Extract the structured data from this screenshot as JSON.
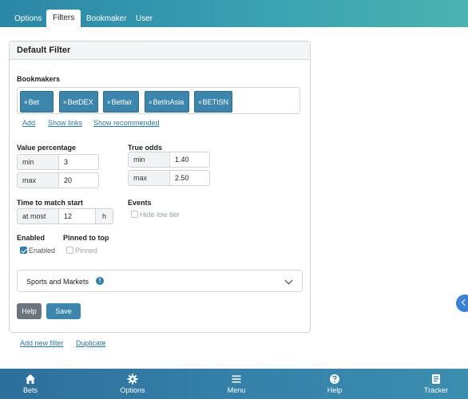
{
  "tabs": [
    {
      "label": "Options",
      "active": false
    },
    {
      "label": "Filters",
      "active": true
    },
    {
      "label": "Bookmaker",
      "active": false
    },
    {
      "label": "User",
      "active": false
    }
  ],
  "card": {
    "title": "Default Filter"
  },
  "bookmakers": {
    "label": "Bookmakers",
    "chips": [
      "Bet",
      "BetDEX",
      "Betfair",
      "BetInAsia",
      "BETISN"
    ],
    "remove_glyph": "×",
    "links": {
      "add": "Add",
      "show_links": "Show links",
      "show_recommended": "Show recommended"
    }
  },
  "value_percentage": {
    "label": "Value percentage",
    "min_label": "min",
    "min_value": "3",
    "max_label": "max",
    "max_value": "20"
  },
  "true_odds": {
    "label": "True odds",
    "min_label": "min",
    "min_value": "1.40",
    "max_label": "max",
    "max_value": "2.50"
  },
  "time_to_match": {
    "label": "Time to match start",
    "prefix": "at most",
    "value": "12",
    "unit": "h"
  },
  "events": {
    "label": "Events",
    "hide_low_tier": {
      "label": "Hide low tier",
      "checked": false
    }
  },
  "enabled": {
    "label": "Enabled",
    "checkbox_label": "Enabled",
    "checked": true
  },
  "pinned": {
    "label": "Pinned to top",
    "checkbox_label": "Pinned",
    "checked": false
  },
  "sports_markets": {
    "label": "Sports and Markets",
    "info_glyph": "!"
  },
  "buttons": {
    "help": "Help",
    "save": "Save"
  },
  "footer_links": {
    "add_new_filter": "Add new filter",
    "duplicate": "Duplicate"
  },
  "bottom_nav": [
    {
      "label": "Bets",
      "icon": "home-icon"
    },
    {
      "label": "Options",
      "icon": "gear-icon"
    },
    {
      "label": "Menu",
      "icon": "hamburger-icon"
    },
    {
      "label": "Help",
      "icon": "question-icon"
    },
    {
      "label": "Tracker",
      "icon": "tracker-icon"
    }
  ],
  "colors": {
    "accent": "#3c86ad",
    "header_teal": "#3aa1b2",
    "bottom_blue": "#3480a9",
    "help_button": "#6c757d",
    "side_toggle": "#3b82d6"
  }
}
